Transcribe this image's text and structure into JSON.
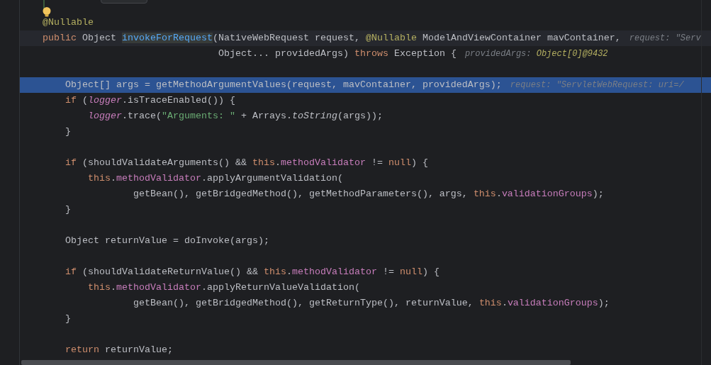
{
  "editor": {
    "lines": [
      {
        "code": [
          {
            "kind": "ann",
            "text": "@Nullable"
          }
        ],
        "execution_point": false,
        "caret_line": false
      },
      {
        "code": [
          {
            "kind": "kw",
            "text": "public "
          },
          {
            "kind": "plain",
            "text": "Object "
          },
          {
            "kind": "decl",
            "text": "invokeForRequest"
          },
          {
            "kind": "plain",
            "text": "(NativeWebRequest request, "
          },
          {
            "kind": "ann",
            "text": "@Nullable"
          },
          {
            "kind": "plain",
            "text": " ModelAndViewContainer mavContainer,"
          }
        ],
        "hint": [
          {
            "kind": "label",
            "text": "request: \"Serv"
          }
        ],
        "execution_point": false,
        "caret_line": true
      },
      {
        "code": [
          {
            "kind": "plain",
            "text": "                               Object... providedArgs) "
          },
          {
            "kind": "kw",
            "text": "throws"
          },
          {
            "kind": "plain",
            "text": " Exception {"
          }
        ],
        "hint": [
          {
            "kind": "label",
            "text": "providedArgs: "
          },
          {
            "kind": "value",
            "text": "Object[0]@9432"
          }
        ],
        "execution_point": false,
        "caret_line": false
      },
      {
        "execution_point": false,
        "caret_line": false
      },
      {
        "code": [
          {
            "kind": "plain",
            "text": "    Object[] args = getMethodArgumentValues(request, mavContainer, providedArgs);"
          }
        ],
        "hint": [
          {
            "kind": "label",
            "text": "request: \"ServletWebRequest: uri=/"
          }
        ],
        "execution_point": true,
        "caret_line": false
      },
      {
        "code": [
          {
            "kind": "kw",
            "text": "    if"
          },
          {
            "kind": "plain",
            "text": " ("
          },
          {
            "kind": "fieldi",
            "text": "logger"
          },
          {
            "kind": "plain",
            "text": ".isTraceEnabled()) {"
          }
        ],
        "execution_point": false,
        "caret_line": false
      },
      {
        "code": [
          {
            "kind": "fieldi",
            "text": "        logger"
          },
          {
            "kind": "plain",
            "text": ".trace("
          },
          {
            "kind": "str",
            "text": "\"Arguments: \""
          },
          {
            "kind": "plain",
            "text": " + Arrays."
          },
          {
            "kind": "stat",
            "text": "toString"
          },
          {
            "kind": "plain",
            "text": "(args));"
          }
        ],
        "execution_point": false,
        "caret_line": false
      },
      {
        "code": [
          {
            "kind": "plain",
            "text": "    }"
          }
        ],
        "execution_point": false,
        "caret_line": false
      },
      {
        "execution_point": false,
        "caret_line": false
      },
      {
        "code": [
          {
            "kind": "kw",
            "text": "    if"
          },
          {
            "kind": "plain",
            "text": " (shouldValidateArguments() && "
          },
          {
            "kind": "kw",
            "text": "this"
          },
          {
            "kind": "plain",
            "text": "."
          },
          {
            "kind": "field",
            "text": "methodValidator"
          },
          {
            "kind": "plain",
            "text": " != "
          },
          {
            "kind": "kw",
            "text": "null"
          },
          {
            "kind": "plain",
            "text": ") {"
          }
        ],
        "execution_point": false,
        "caret_line": false
      },
      {
        "code": [
          {
            "kind": "kw",
            "text": "        this"
          },
          {
            "kind": "plain",
            "text": "."
          },
          {
            "kind": "field",
            "text": "methodValidator"
          },
          {
            "kind": "plain",
            "text": ".applyArgumentValidation("
          }
        ],
        "execution_point": false,
        "caret_line": false
      },
      {
        "code": [
          {
            "kind": "plain",
            "text": "                getBean(), getBridgedMethod(), getMethodParameters(), args, "
          },
          {
            "kind": "kw",
            "text": "this"
          },
          {
            "kind": "plain",
            "text": "."
          },
          {
            "kind": "field",
            "text": "validationGroups"
          },
          {
            "kind": "plain",
            "text": ");"
          }
        ],
        "execution_point": false,
        "caret_line": false
      },
      {
        "code": [
          {
            "kind": "plain",
            "text": "    }"
          }
        ],
        "execution_point": false,
        "caret_line": false
      },
      {
        "execution_point": false,
        "caret_line": false
      },
      {
        "code": [
          {
            "kind": "plain",
            "text": "    Object returnValue = doInvoke(args);"
          }
        ],
        "execution_point": false,
        "caret_line": false
      },
      {
        "execution_point": false,
        "caret_line": false
      },
      {
        "code": [
          {
            "kind": "kw",
            "text": "    if"
          },
          {
            "kind": "plain",
            "text": " (shouldValidateReturnValue() && "
          },
          {
            "kind": "kw",
            "text": "this"
          },
          {
            "kind": "plain",
            "text": "."
          },
          {
            "kind": "field",
            "text": "methodValidator"
          },
          {
            "kind": "plain",
            "text": " != "
          },
          {
            "kind": "kw",
            "text": "null"
          },
          {
            "kind": "plain",
            "text": ") {"
          }
        ],
        "execution_point": false,
        "caret_line": false
      },
      {
        "code": [
          {
            "kind": "kw",
            "text": "        this"
          },
          {
            "kind": "plain",
            "text": "."
          },
          {
            "kind": "field",
            "text": "methodValidator"
          },
          {
            "kind": "plain",
            "text": ".applyReturnValueValidation("
          }
        ],
        "execution_point": false,
        "caret_line": false
      },
      {
        "code": [
          {
            "kind": "plain",
            "text": "                getBean(), getBridgedMethod(), getReturnType(), returnValue, "
          },
          {
            "kind": "kw",
            "text": "this"
          },
          {
            "kind": "plain",
            "text": "."
          },
          {
            "kind": "field",
            "text": "validationGroups"
          },
          {
            "kind": "plain",
            "text": ");"
          }
        ],
        "execution_point": false,
        "caret_line": false
      },
      {
        "code": [
          {
            "kind": "plain",
            "text": "    }"
          }
        ],
        "execution_point": false,
        "caret_line": false
      },
      {
        "execution_point": false,
        "caret_line": false
      },
      {
        "code": [
          {
            "kind": "kw",
            "text": "    return"
          },
          {
            "kind": "plain",
            "text": " returnValue;"
          }
        ],
        "execution_point": false,
        "caret_line": false
      }
    ]
  }
}
